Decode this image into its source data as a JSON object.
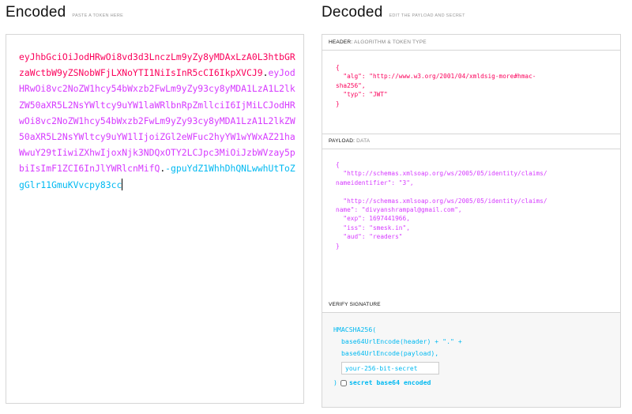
{
  "encoded": {
    "title": "Encoded",
    "hint": "PASTE A TOKEN HERE",
    "token_header": "eyJhbGciOiJodHRwOi8vd3d3LnczLm9yZy8yMDAxLzA0L3htbGRzaWctbW9yZSNobWFjLXNoYTI1NiIsInR5cCI6IkpXVCJ9",
    "token_payload": "eyJodHRwOi8vc2NoZW1hcy54bWxzb2FwLm9yZy93cy8yMDA1LzA1L2lkZW50aXR5L2NsYWltcy9uYW1laWRlbnRpZmllciI6IjMiLCJodHRwOi8vc2NoZW1hcy54bWxzb2FwLm9yZy93cy8yMDA1LzA1L2lkZW50aXR5L2NsYWltcy9uYW1lIjoiZGl2eWFuc2hyYW1wYWxAZ21haWwuY29tIiwiZXhwIjoxNjk3NDQxOTY2LCJpc3MiOiJzbWVzay5pbiIsImF1ZCI6InJlYWRlcnMifQ",
    "token_signature": "-gpuYdZ1WhhDhQNLwwhUtToZgGlr11GmuKVvcpy83cc",
    "dot": "."
  },
  "decoded": {
    "title": "Decoded",
    "hint": "EDIT THE PAYLOAD AND SECRET",
    "header_section": {
      "title": "HEADER:",
      "subtitle": "ALGORITHM & TOKEN TYPE",
      "json": "{\n  \"alg\": \"http://www.w3.org/2001/04/xmldsig-more#hmac-\nsha256\",\n  \"typ\": \"JWT\"\n}"
    },
    "payload_section": {
      "title": "PAYLOAD:",
      "subtitle": "DATA",
      "json": "{\n  \"http://schemas.xmlsoap.org/ws/2005/05/identity/claims/\nnameidentifier\": \"3\",\n\n  \"http://schemas.xmlsoap.org/ws/2005/05/identity/claims/\nname\": \"divyanshrampal@gmail.com\",\n  \"exp\": 1697441966,\n  \"iss\": \"smesk.in\",\n  \"aud\": \"readers\"\n}"
    },
    "verify_section": {
      "title": "VERIFY SIGNATURE",
      "line1": "HMACSHA256(",
      "line2": "base64UrlEncode(header) + \".\" +",
      "line3": "base64UrlEncode(payload),",
      "secret_placeholder": "your-256-bit-secret",
      "close_paren": ")",
      "checkbox_label": "secret base64 encoded",
      "checkbox_checked": false
    }
  },
  "colors": {
    "header": "#fb015b",
    "payload": "#d63aff",
    "signature": "#00b9f1"
  }
}
